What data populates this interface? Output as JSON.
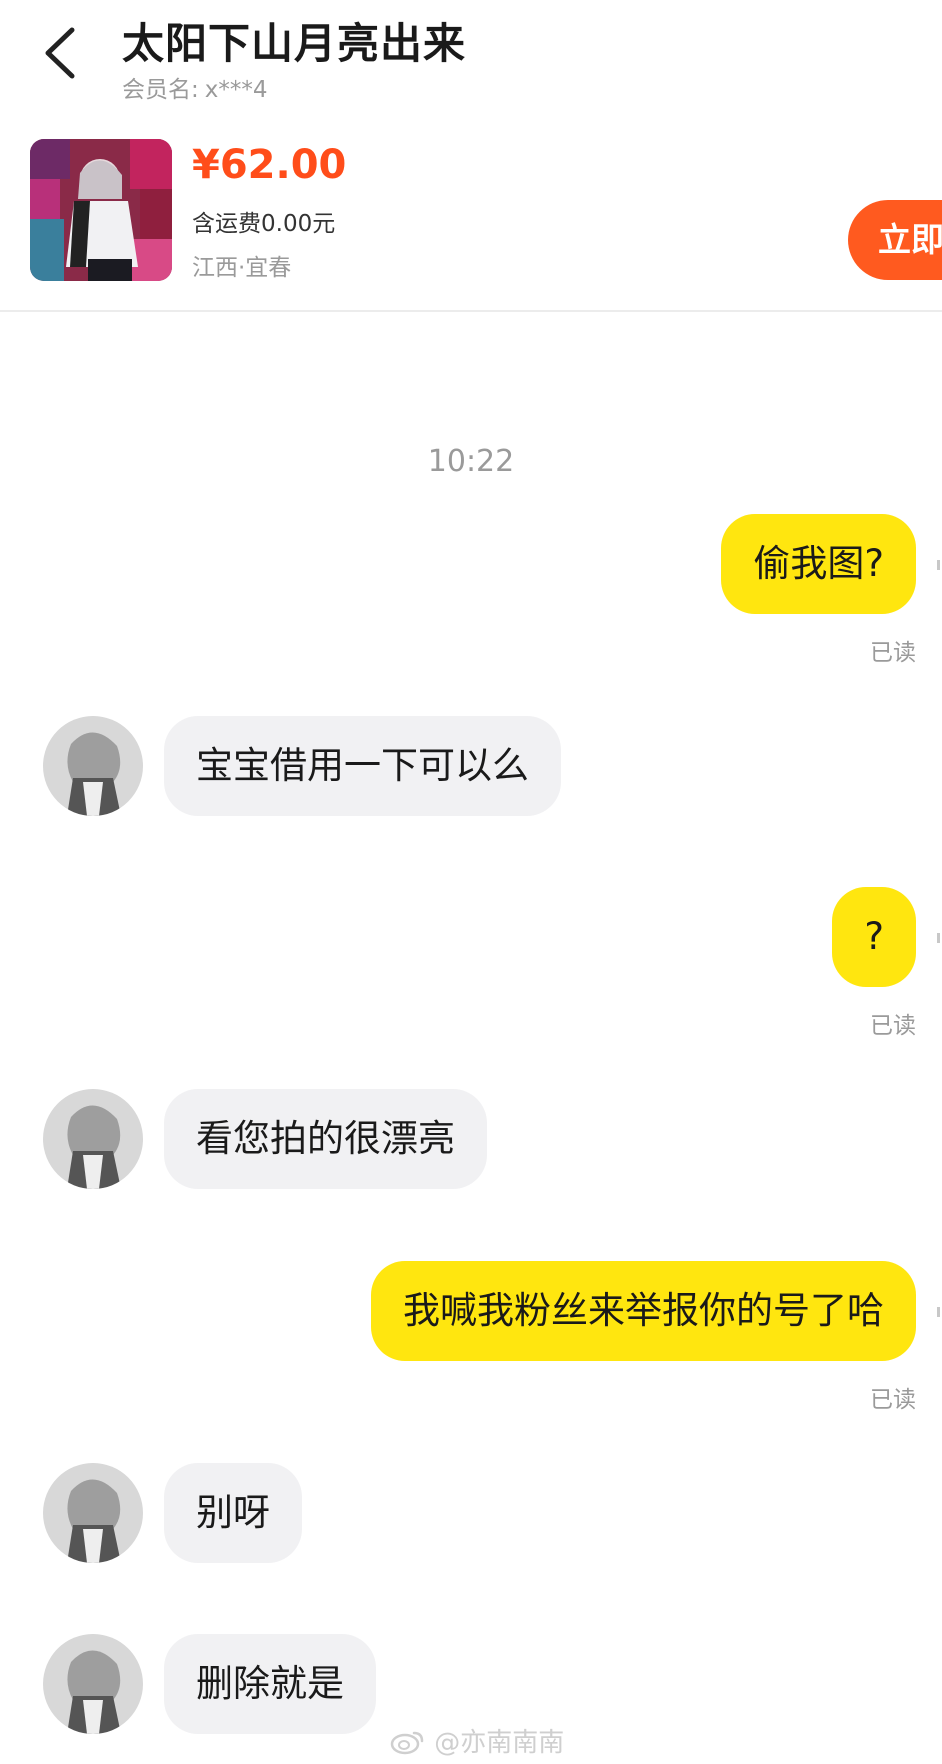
{
  "header": {
    "title": "太阳下山月亮出来",
    "member_label": "会员名:",
    "member_value": "x***4"
  },
  "product": {
    "price": "¥62.00",
    "shipping": "含运费0.00元",
    "location": "江西·宜春",
    "buy_button": "立即"
  },
  "chat": {
    "timestamp": "10:22",
    "messages": [
      {
        "from": "me",
        "text": "偷我图?",
        "status": "已读"
      },
      {
        "from": "them",
        "text": "宝宝借用一下可以么"
      },
      {
        "from": "me",
        "text": "?",
        "status": "已读"
      },
      {
        "from": "them",
        "text": "看您拍的很漂亮"
      },
      {
        "from": "me",
        "text": "我喊我粉丝来举报你的号了哈",
        "status": "已读"
      },
      {
        "from": "them",
        "text": "别呀"
      },
      {
        "from": "them",
        "text": "删除就是"
      }
    ]
  },
  "watermark": "@亦南南南",
  "colors": {
    "accent": "#ff5a1f",
    "price": "#ff4d1a",
    "my_bubble": "#ffe60f",
    "their_bubble": "#f1f1f3"
  },
  "icons": {
    "back": "chevron-left-icon",
    "watermark": "weibo-logo-icon"
  }
}
